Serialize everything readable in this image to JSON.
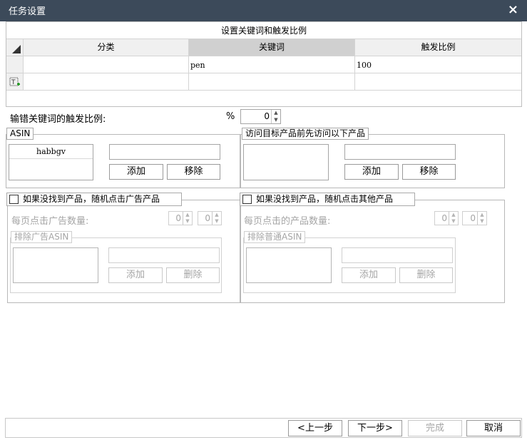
{
  "window": {
    "title": "任务设置",
    "close_glyph": "×"
  },
  "grid": {
    "caption": "设置关键词和触发比例",
    "columns": [
      "分类",
      "关键词",
      "触发比例"
    ],
    "rows": [
      {
        "category": "",
        "keyword": "pen",
        "ratio": "100"
      }
    ],
    "new_row_icon": "new-row-icon"
  },
  "typo": {
    "label": "输错关键词的触发比例:",
    "unit": "%",
    "value": "0"
  },
  "asin": {
    "legend": "ASIN",
    "items": [
      "habbgv"
    ],
    "input_value": "",
    "add_label": "添加",
    "remove_label": "移除"
  },
  "visit": {
    "legend": "访问目标产品前先访问以下产品",
    "items": [],
    "input_value": "",
    "add_label": "添加",
    "remove_label": "移除"
  },
  "ad_fallback": {
    "checkbox_label": "如果没找到产品，随机点击广告产品",
    "checked": false,
    "count_label": "每页点击广告数量:",
    "min": "0",
    "max": "0",
    "exclude_legend": "排除广告ASIN",
    "add_label": "添加",
    "delete_label": "删除"
  },
  "other_fallback": {
    "checkbox_label": "如果没找到产品，随机点击其他产品",
    "checked": false,
    "count_label": "每页点击的产品数量:",
    "min": "0",
    "max": "0",
    "exclude_legend": "排除普通ASIN",
    "add_label": "添加",
    "delete_label": "删除"
  },
  "footer": {
    "prev_label": "<上一步",
    "next_label": "下一步>",
    "finish_label": "完成",
    "cancel_label": "取消"
  },
  "colors": {
    "titlebar": "#3c4a5a",
    "selected_header": "#d0d0d0"
  }
}
